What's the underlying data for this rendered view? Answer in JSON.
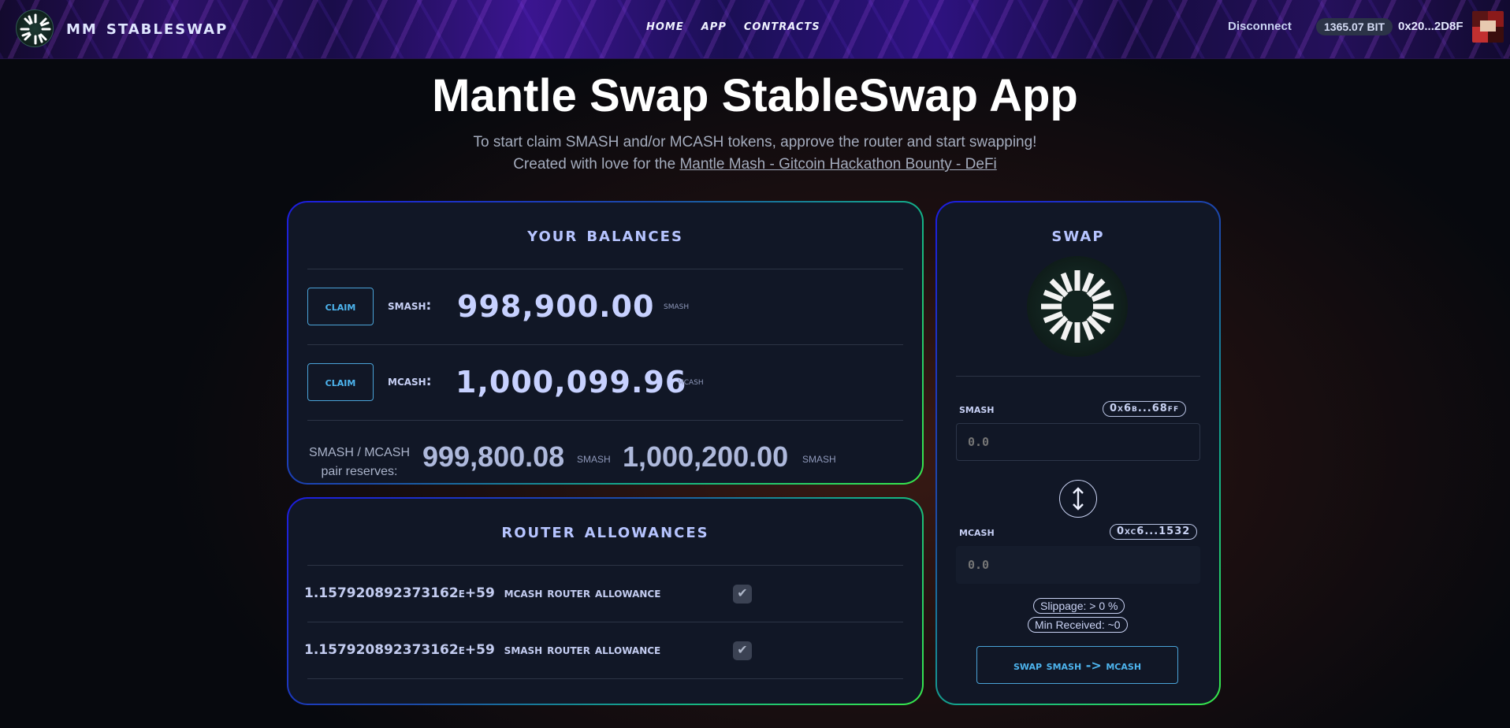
{
  "header": {
    "brand": "MM StableSwap",
    "nav": [
      "HOME",
      "APP",
      "CONTRACTS"
    ],
    "disconnect": "Disconnect",
    "balance": "1365.07 BIT",
    "address": "0x20...2D8F"
  },
  "page": {
    "title": "Mantle Swap StableSwap App",
    "subtitle": "To start claim SMASH and/or MCASH tokens, approve the router and start swapping!",
    "credit_prefix": "Created with love for the",
    "credit_link": "Mantle Mash - Gitcoin Hackathon Bounty - DeFi"
  },
  "balances": {
    "title": "YOUR BALANCES",
    "claim_label": "CLAIM",
    "rows": [
      {
        "token": "SMASH:",
        "amount": "998,900.00",
        "unit": "SMASH"
      },
      {
        "token": "MCASH:",
        "amount": "1,000,099.96",
        "unit": "MCASH"
      }
    ],
    "reserves": {
      "label_line1": "SMASH / MCASH",
      "label_line2": "pair reserves:",
      "value1": "999,800.08",
      "unit1": "SMASH",
      "value2": "1,000,200.00",
      "unit2": "SMASH"
    }
  },
  "allowances": {
    "title": "ROUTER ALLOWANCES",
    "rows": [
      {
        "value": "1.157920892373162e+59",
        "label": "MCASH ROUTER ALLOWANCE"
      },
      {
        "value": "1.157920892373162e+59",
        "label": "SMASH ROUTER ALLOWANCE"
      }
    ]
  },
  "swap": {
    "title": "SWAP",
    "from_token": "SMASH",
    "from_address": "0x6b...68ff",
    "from_placeholder": "0.0",
    "to_token": "MCASH",
    "to_address": "0xc6...1532",
    "to_placeholder": "0.0",
    "slippage": "Slippage: > 0 %",
    "min_received": "Min Received: ~0",
    "button": "SWAP SMASH -> MCASH"
  }
}
